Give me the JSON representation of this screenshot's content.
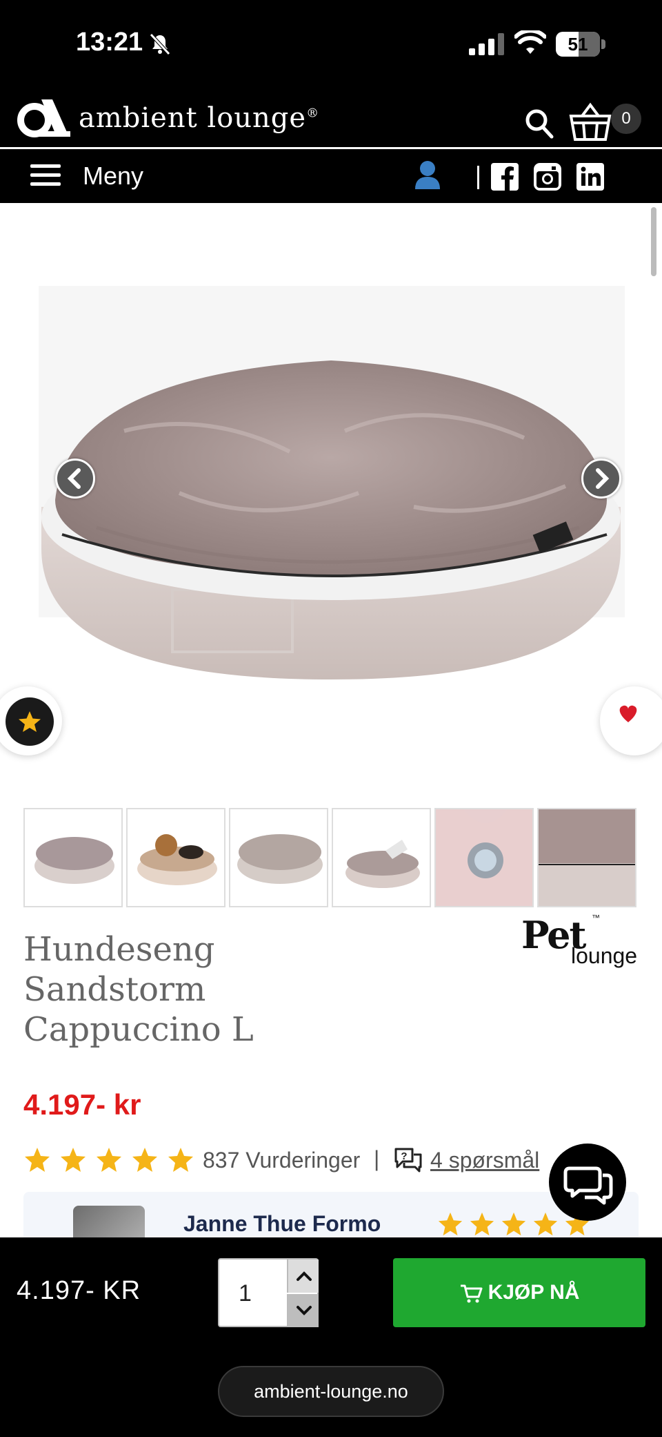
{
  "status_bar": {
    "time": "13:21",
    "battery": "51",
    "battery_level": 0.51
  },
  "header": {
    "logo_text": "ambient lounge",
    "logo_mark": "®",
    "cart_count": "0"
  },
  "nav": {
    "menu_label": "Meny"
  },
  "social_icons": [
    "facebook-icon",
    "instagram-icon",
    "linkedin-icon"
  ],
  "gallery": {
    "thumbnails": [
      "thumb-1",
      "thumb-2",
      "thumb-3",
      "thumb-4",
      "thumb-5",
      "thumb-6"
    ]
  },
  "product": {
    "title_lines": [
      "Hundeseng",
      "Sandstorm",
      "Cappuccino L"
    ],
    "brand_logo": {
      "top": "Pet",
      "bottom": "lounge",
      "tm": "™"
    },
    "price": "4.197- kr"
  },
  "rating": {
    "stars": 5,
    "count_text": "837 Vurderinger",
    "separator": "|",
    "questions_link": "4 spørsmål"
  },
  "review": {
    "reviewer_name": "Janne Thue Formo",
    "stars": 5
  },
  "buy_bar": {
    "price": "4.197- KR",
    "quantity": "1",
    "buy_label": "KJØP NÅ"
  },
  "browser": {
    "url": "ambient-lounge.no"
  },
  "colors": {
    "price_red": "#e01a1a",
    "star_yellow": "#f5b417",
    "buy_green": "#1fa830",
    "reviewer_navy": "#1d2a4d"
  }
}
